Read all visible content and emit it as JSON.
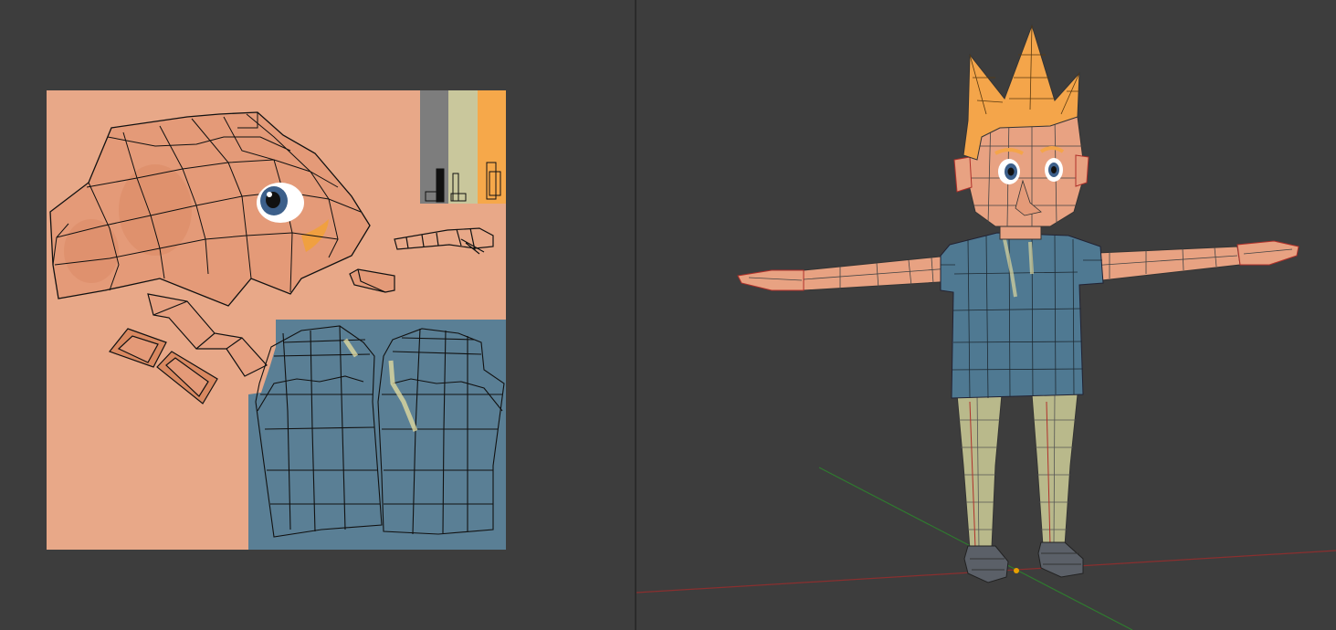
{
  "uv_editor": {
    "colors": {
      "skin": "#e8a888",
      "shirt": "#5a7f95",
      "pants": "#c9c79c",
      "hair": "#f6a84a",
      "gray": "#7d7d7d",
      "wire": "#111111"
    }
  },
  "viewport": {
    "colors": {
      "skin": "#e8a282",
      "skin_shade": "#c9735a",
      "shirt": "#4f7992",
      "pants": "#b9b98b",
      "hair": "#f4a54a",
      "shoe": "#5b6068",
      "x_axis": "#8a2f2f",
      "y_axis": "#2f7a2f",
      "origin": "#e8a000"
    }
  }
}
